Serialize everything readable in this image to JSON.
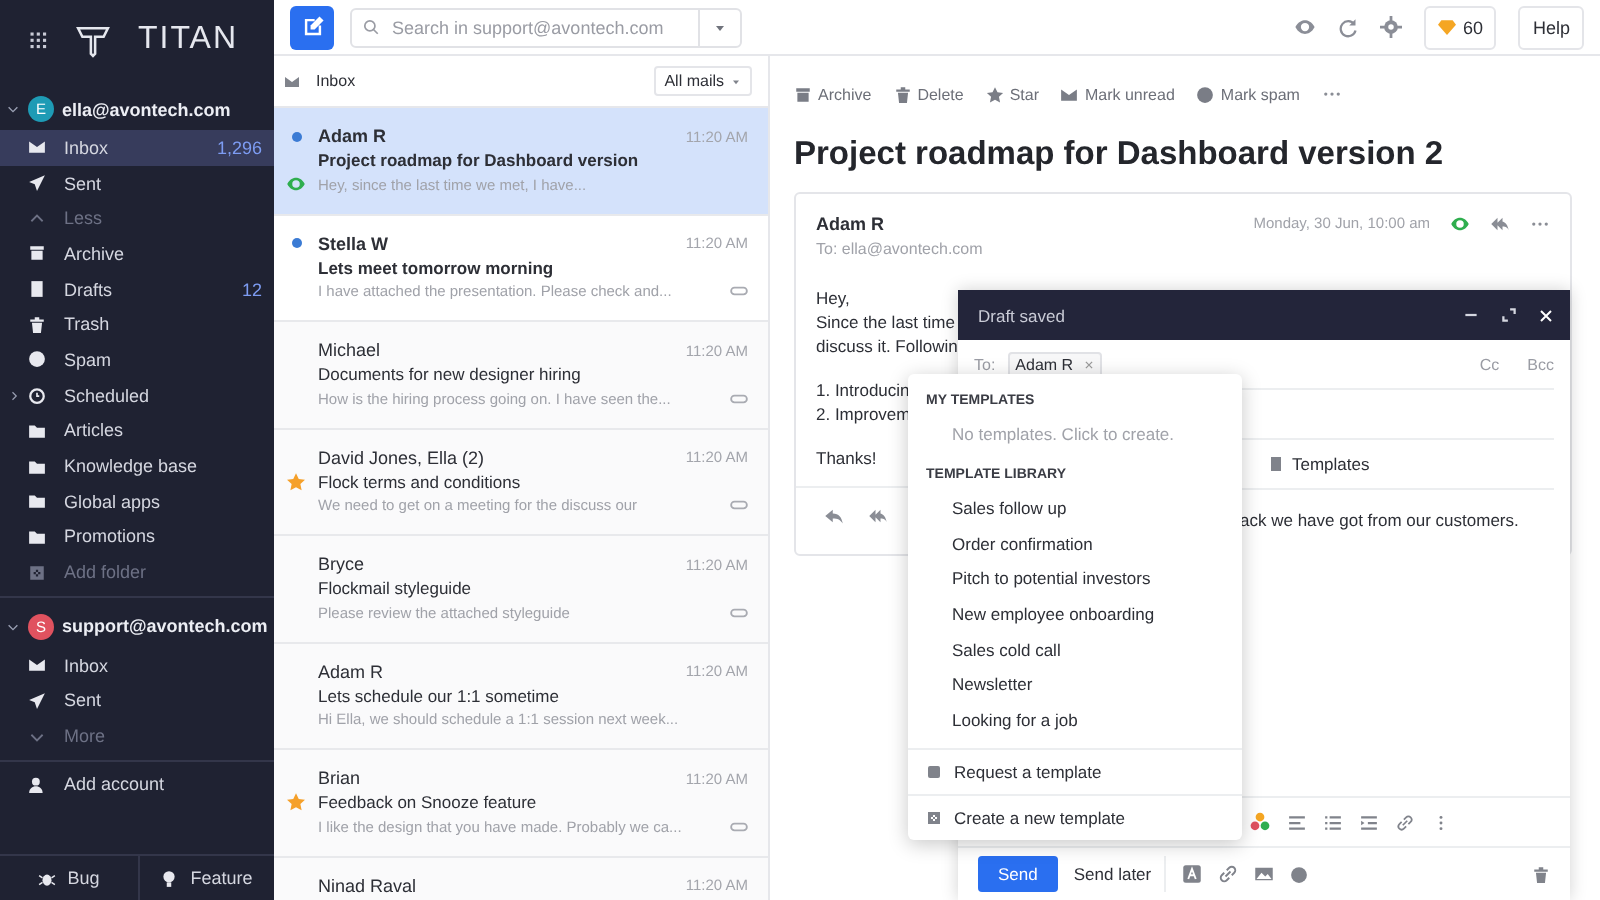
{
  "logo": {
    "text": "TITAN"
  },
  "accounts": [
    {
      "email": "ella@avontech.com",
      "initial": "E",
      "color": "#1e9bb5",
      "expanded": true,
      "items": [
        {
          "kind": "inbox",
          "label": "Inbox",
          "count": "1,296",
          "selected": true
        },
        {
          "kind": "sent",
          "label": "Sent",
          "selected": false
        },
        {
          "kind": "less",
          "label": "Less",
          "selected": false
        },
        {
          "kind": "archive",
          "label": "Archive",
          "selected": false
        },
        {
          "kind": "drafts",
          "label": "Drafts",
          "count": "12",
          "selected": false
        },
        {
          "kind": "trash",
          "label": "Trash",
          "selected": false
        },
        {
          "kind": "spam",
          "label": "Spam",
          "selected": false
        },
        {
          "kind": "scheduled",
          "label": "Scheduled",
          "expanded": false,
          "selected": false
        },
        {
          "kind": "folder",
          "label": "Articles",
          "selected": false
        },
        {
          "kind": "folder",
          "label": "Knowledge base",
          "selected": false
        },
        {
          "kind": "folder",
          "label": "Global apps",
          "selected": false
        },
        {
          "kind": "folder",
          "label": "Promotions",
          "selected": false
        },
        {
          "kind": "add",
          "label": "Add folder",
          "selected": false
        }
      ]
    },
    {
      "email": "support@avontech.com",
      "initial": "S",
      "color": "#e0525f",
      "expanded": true,
      "items": [
        {
          "kind": "inbox",
          "label": "Inbox",
          "selected": false
        },
        {
          "kind": "sent",
          "label": "Sent",
          "selected": false
        },
        {
          "kind": "more",
          "label": "More",
          "selected": false
        }
      ]
    }
  ],
  "add_account": "Add account",
  "footer_buttons": [
    {
      "kind": "bug",
      "label": "Bug"
    },
    {
      "kind": "feature",
      "label": "Feature"
    }
  ],
  "search": {
    "placeholder": "Search in support@avontech.com"
  },
  "credits": "60",
  "help": "Help",
  "list_header": {
    "title": "Inbox",
    "filter": "All mails"
  },
  "emails": [
    {
      "sender": "Adam R",
      "time": "11:20 AM",
      "subject": "Project roadmap for Dashboard version",
      "preview": "Hey, since the last time we met, I have...",
      "unread": true,
      "starred": false,
      "tracked": true,
      "has_attachment": false,
      "selected": true
    },
    {
      "sender": "Stella W",
      "time": "11:20 AM",
      "subject": "Lets meet tomorrow morning",
      "preview": "I have attached the presentation. Please check and...",
      "unread": true,
      "starred": false,
      "tracked": false,
      "has_attachment": true,
      "selected": false
    },
    {
      "sender": "Michael",
      "time": "11:20 AM",
      "subject": "Documents for new designer hiring",
      "preview": "How is the hiring process going on. I have seen the...",
      "unread": false,
      "starred": false,
      "tracked": false,
      "has_attachment": true,
      "selected": false
    },
    {
      "sender": "David Jones, Ella (2)",
      "time": "11:20 AM",
      "subject": "Flock terms and conditions",
      "preview": "We need to get on a meeting for the discuss our",
      "unread": false,
      "starred": true,
      "tracked": false,
      "has_attachment": true,
      "selected": false
    },
    {
      "sender": "Bryce",
      "time": "11:20 AM",
      "subject": "Flockmail styleguide",
      "preview": "Please review the attached styleguide",
      "unread": false,
      "starred": false,
      "tracked": false,
      "has_attachment": true,
      "selected": false
    },
    {
      "sender": "Adam R",
      "time": "11:20 AM",
      "subject": "Lets schedule our 1:1 sometime",
      "preview": "Hi Ella, we should schedule a 1:1 session next week...",
      "unread": false,
      "starred": false,
      "tracked": false,
      "has_attachment": false,
      "selected": false
    },
    {
      "sender": "Brian",
      "time": "11:20 AM",
      "subject": "Feedback on Snooze feature",
      "preview": "I like the design that you have made. Probably we ca...",
      "unread": false,
      "starred": true,
      "tracked": false,
      "has_attachment": true,
      "selected": false
    },
    {
      "sender": "Ninad Raval",
      "time": "11:20 AM",
      "unread": false,
      "selected": false
    }
  ],
  "actions": [
    {
      "kind": "archive",
      "label": "Archive"
    },
    {
      "kind": "delete",
      "label": "Delete"
    },
    {
      "kind": "star",
      "label": "Star"
    },
    {
      "kind": "unread",
      "label": "Mark unread"
    },
    {
      "kind": "spam",
      "label": "Mark spam"
    }
  ],
  "message": {
    "title": "Project roadmap for Dashboard version 2",
    "sender": "Adam R",
    "to": "To: ella@avontech.com",
    "date": "Monday, 30 Jun, 10:00 am",
    "tracked": true,
    "paragraphs": [
      [
        "Hey,",
        "Since the last time",
        "discuss it. Followin"
      ],
      [
        "1. Introducin",
        "2. Improvem"
      ],
      [
        "Thanks!"
      ]
    ]
  },
  "compose": {
    "title": "Draft saved",
    "to_label": "To:",
    "recipients": [
      "Adam R"
    ],
    "cc": "Cc",
    "bcc": "Bcc",
    "templates_button": "Templates",
    "body": "ack we have got from our customers.",
    "send": "Send",
    "send_later": "Send later"
  },
  "templates_menu": {
    "my_heading": "MY TEMPLATES",
    "my_empty": "No templates. Click to create.",
    "library_heading": "TEMPLATE LIBRARY",
    "library": [
      "Sales follow up",
      "Order confirmation",
      "Pitch to potential investors",
      "New employee onboarding",
      "Sales cold call",
      "Newsletter",
      "Looking for a job"
    ],
    "footer": [
      {
        "kind": "request",
        "label": "Request a template"
      },
      {
        "kind": "create",
        "label": "Create a new template"
      }
    ]
  }
}
